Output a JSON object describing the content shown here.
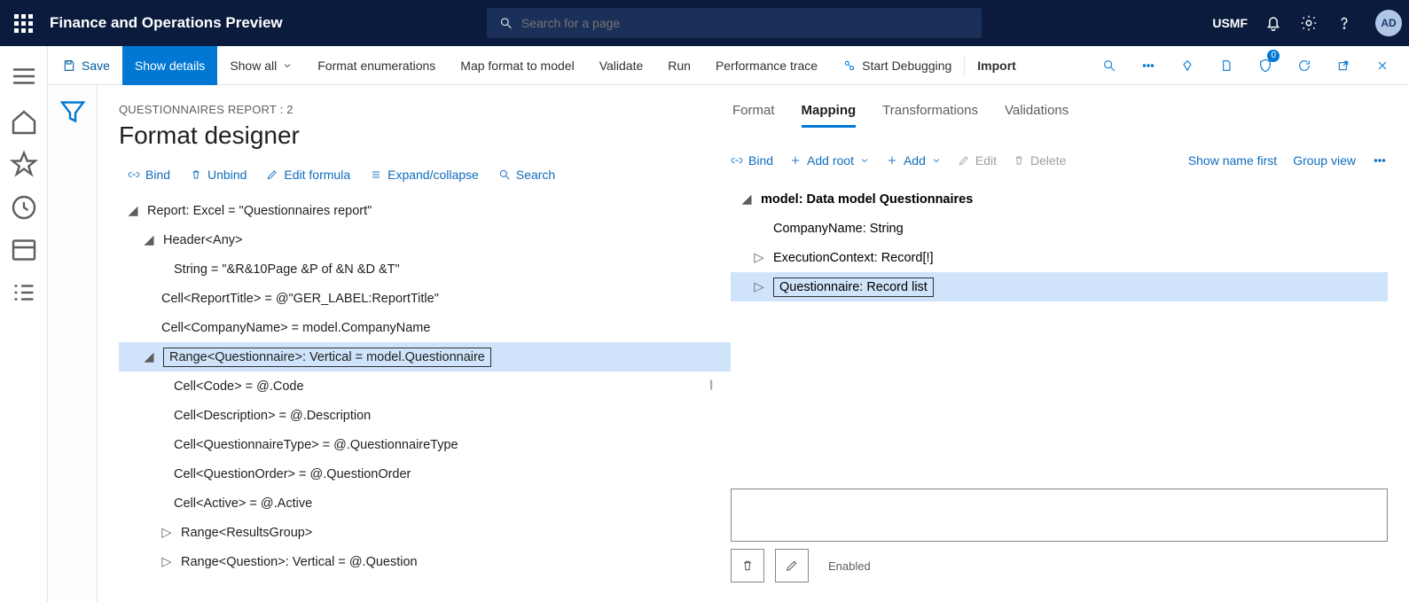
{
  "topbar": {
    "app_title": "Finance and Operations Preview",
    "search_placeholder": "Search for a page",
    "company": "USMF",
    "avatar": "AD"
  },
  "actionbar": {
    "save": "Save",
    "show_details": "Show details",
    "show_all": "Show all",
    "format_enum": "Format enumerations",
    "map_format": "Map format to model",
    "validate": "Validate",
    "run": "Run",
    "perf_trace": "Performance trace",
    "start_debug": "Start Debugging",
    "import": "Import",
    "badge": "0"
  },
  "page": {
    "breadcrumb": "QUESTIONNAIRES REPORT : 2",
    "title": "Format designer"
  },
  "left_toolbar": {
    "bind": "Bind",
    "unbind": "Unbind",
    "edit_formula": "Edit formula",
    "expand": "Expand/collapse",
    "search": "Search"
  },
  "format_tree": {
    "r0": "Report: Excel = \"Questionnaires report\"",
    "r1": "Header<Any>",
    "r2": "String = \"&R&10Page &P of &N &D &T\"",
    "r3": "Cell<ReportTitle> = @\"GER_LABEL:ReportTitle\"",
    "r4": "Cell<CompanyName> = model.CompanyName",
    "r5": "Range<Questionnaire>: Vertical = model.Questionnaire",
    "r6": "Cell<Code> = @.Code",
    "r7": "Cell<Description> = @.Description",
    "r8": "Cell<QuestionnaireType> = @.QuestionnaireType",
    "r9": "Cell<QuestionOrder> = @.QuestionOrder",
    "r10": "Cell<Active> = @.Active",
    "r11": "Range<ResultsGroup>",
    "r12": "Range<Question>: Vertical = @.Question"
  },
  "tabs": {
    "format": "Format",
    "mapping": "Mapping",
    "transformations": "Transformations",
    "validations": "Validations"
  },
  "map_toolbar": {
    "bind": "Bind",
    "add_root": "Add root",
    "add": "Add",
    "edit": "Edit",
    "delete": "Delete",
    "show_name": "Show name first",
    "group_view": "Group view"
  },
  "model_tree": {
    "m0": "model: Data model Questionnaires",
    "m1": "CompanyName: String",
    "m2": "ExecutionContext: Record[!]",
    "m3": "Questionnaire: Record list"
  },
  "footer": {
    "enabled": "Enabled"
  }
}
